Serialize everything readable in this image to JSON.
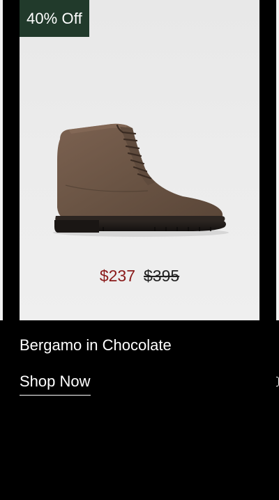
{
  "product": {
    "badge": "40% Off",
    "sale_price": "$237",
    "original_price": "$395",
    "name": "Bergamo in Chocolate",
    "cta_label": "Shop Now",
    "image_icon": "brown-suede-lace-up-boot",
    "colors": {
      "badge_bg": "#213a2b",
      "sale_price": "#8a1a1a",
      "boot_suede": "#6a5444",
      "sole": "#1f1b19"
    }
  }
}
